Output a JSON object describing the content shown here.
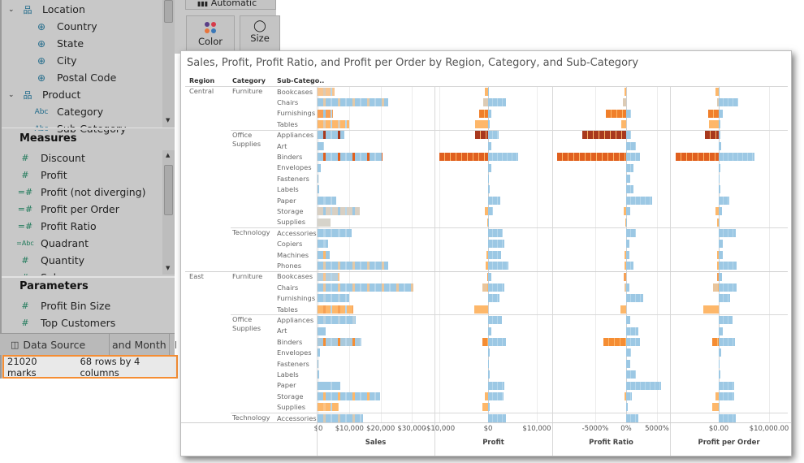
{
  "data_pane": {
    "dimensions": [
      {
        "label": "Location",
        "icon": "hierarchy-icon",
        "expanded": true,
        "children": [
          {
            "label": "Country",
            "icon": "globe-icon"
          },
          {
            "label": "State",
            "icon": "globe-icon"
          },
          {
            "label": "City",
            "icon": "globe-icon"
          },
          {
            "label": "Postal Code",
            "icon": "globe-icon"
          }
        ]
      },
      {
        "label": "Product",
        "icon": "hierarchy-icon",
        "expanded": true,
        "children": [
          {
            "label": "Category",
            "icon": "abc-icon"
          },
          {
            "label": "Sub-Category",
            "icon": "abc-icon"
          }
        ]
      }
    ],
    "measures_header": "Measures",
    "measures": [
      {
        "label": "Discount",
        "icon": "#"
      },
      {
        "label": "Profit",
        "icon": "#"
      },
      {
        "label": "Profit (not diverging)",
        "icon": "=#"
      },
      {
        "label": "Profit per Order",
        "icon": "=#"
      },
      {
        "label": "Profit Ratio",
        "icon": "=#"
      },
      {
        "label": "Quadrant",
        "icon": "=Abc"
      },
      {
        "label": "Quantity",
        "icon": "#"
      },
      {
        "label": "Sales",
        "icon": "#"
      }
    ],
    "parameters_header": "Parameters",
    "parameters": [
      {
        "label": "Profit Bin Size",
        "icon": "#"
      },
      {
        "label": "Top Customers",
        "icon": "#"
      }
    ]
  },
  "tabs": {
    "data_source": "Data Source",
    "sheet1": "and Month",
    "sheet2": "L"
  },
  "status": {
    "marks": "21020 marks",
    "dims": "68 rows by 4 columns"
  },
  "marks_card": {
    "type": "Automatic",
    "color": "Color",
    "size": "Size"
  },
  "colors": {
    "blue": "#9cc8e4",
    "accent": "#f58d33"
  },
  "viz": {
    "title": "Sales, Profit, Profit Ratio, and Profit per Order by Region, Category, and Sub-Category",
    "headers": {
      "region": "Region",
      "category": "Category",
      "subcategory": "Sub-Catego.."
    },
    "axes": [
      {
        "title": "Sales",
        "ticks": [
          {
            "v": 0,
            "t": "$0"
          },
          {
            "v": 10000,
            "t": "$10,000"
          },
          {
            "v": 20000,
            "t": "$20,000"
          },
          {
            "v": 30000,
            "t": "$30,000"
          }
        ]
      },
      {
        "title": "Profit",
        "ticks": [
          {
            "v": -10000,
            "t": "-$10,000"
          },
          {
            "v": 0,
            "t": "$0"
          },
          {
            "v": 10000,
            "t": "$10,000"
          }
        ]
      },
      {
        "title": "Profit Ratio",
        "ticks": [
          {
            "v": -5000,
            "t": "-5000%"
          },
          {
            "v": 0,
            "t": "0%"
          },
          {
            "v": 5000,
            "t": "5000%"
          }
        ]
      },
      {
        "title": "Profit per Order",
        "ticks": [
          {
            "v": 0,
            "t": "$0.00"
          },
          {
            "v": 10000,
            "t": "$10,000.00"
          }
        ]
      }
    ],
    "regions": [
      {
        "name": "Central",
        "categories": [
          {
            "name": "Furniture",
            "subs": [
              {
                "name": "Bookcases",
                "sales": 5500,
                "sc": "#f7c590",
                "sc2": "#dccbb5",
                "profit": [
                  -600,
                  200
                ],
                "ratio": [
                  -260,
                  0
                ],
                "ppo": [
                  -650,
                  200
                ],
                "nc": "#fdb76a"
              },
              {
                "name": "Chairs",
                "sales": 22700,
                "sc": "#9cc8e4",
                "sc2": "#e2c9a8",
                "profit": [
                  -950,
                  3600
                ],
                "ratio": [
                  -470,
                  0
                ],
                "ppo": [
                  -300,
                  3900
                ],
                "nc": "#dccbb5"
              },
              {
                "name": "Furnishings",
                "sales": 4900,
                "sc": "#f7a054",
                "sc2": "#9cc8e4",
                "profit": [
                  -1900,
                  600
                ],
                "ratio": [
                  -3300,
                  800
                ],
                "ppo": [
                  -2100,
                  800
                ],
                "nc": "#f07f2a"
              },
              {
                "name": "Tables",
                "sales": 10200,
                "sc": "#fdb76a",
                "sc2": "#dccbb5",
                "profit": [
                  -2600,
                  350
                ],
                "ratio": [
                  -750,
                  0
                ],
                "ppo": [
                  -1900,
                  300
                ],
                "nc": "#fdb76a"
              }
            ]
          },
          {
            "name": "Office Supplies",
            "subs": [
              {
                "name": "Appliances",
                "sales": 8600,
                "sc": "#9cc8e4",
                "sc2": "#a8391e",
                "profit": [
                  -2600,
                  2200
                ],
                "ratio": [
                  -7100,
                  800
                ],
                "ppo": [
                  -2700,
                  300
                ],
                "nc": "#a8391e"
              },
              {
                "name": "Art",
                "sales": 2100,
                "sc": "#9cc8e4",
                "sc2": "#b9d7ea",
                "profit": [
                  0,
                  600
                ],
                "ratio": [
                  0,
                  1600
                ],
                "ppo": [
                  0,
                  500
                ],
                "nc": "#fdb76a"
              },
              {
                "name": "Binders",
                "sales": 20900,
                "sc": "#9cc8e4",
                "sc2": "#e0601f",
                "profit": [
                  -10000,
                  6200
                ],
                "ratio": [
                  -11200,
                  2200
                ],
                "ppo": [
                  -8500,
                  7100
                ],
                "nc": "#e0601f"
              },
              {
                "name": "Envelopes",
                "sales": 1000,
                "sc": "#9cc8e4",
                "sc2": "#9cc8e4",
                "profit": [
                  0,
                  600
                ],
                "ratio": [
                  0,
                  1200
                ],
                "ppo": [
                  0,
                  300
                ],
                "nc": "#fdb76a"
              },
              {
                "name": "Fasteners",
                "sales": 300,
                "sc": "#9cc8e4",
                "sc2": "#9cc8e4",
                "profit": [
                  0,
                  100
                ],
                "ratio": [
                  0,
                  650
                ],
                "ppo": [
                  0,
                  150
                ],
                "nc": "#fdb76a"
              },
              {
                "name": "Labels",
                "sales": 500,
                "sc": "#9cc8e4",
                "sc2": "#9cc8e4",
                "profit": [
                  0,
                  300
                ],
                "ratio": [
                  0,
                  1200
                ],
                "ppo": [
                  0,
                  300
                ],
                "nc": "#fdb76a"
              },
              {
                "name": "Paper",
                "sales": 6000,
                "sc": "#9cc8e4",
                "sc2": "#b2d4ea",
                "profit": [
                  0,
                  2500
                ],
                "ratio": [
                  0,
                  4200
                ],
                "ppo": [
                  0,
                  2100
                ],
                "nc": "#fdb76a"
              },
              {
                "name": "Storage",
                "sales": 13500,
                "sc": "#d8cfc2",
                "sc2": "#9cc8e4",
                "profit": [
                  -600,
                  1000
                ],
                "ratio": [
                  -400,
                  650
                ],
                "ppo": [
                  -650,
                  650
                ],
                "nc": "#fdb76a"
              },
              {
                "name": "Supplies",
                "sales": 4200,
                "sc": "#d6d3ca",
                "sc2": "#d6d3ca",
                "profit": [
                  -200,
                  100
                ],
                "ratio": [
                  -100,
                  100
                ],
                "ppo": [
                  -300,
                  100
                ],
                "nc": "#fdb76a"
              }
            ]
          },
          {
            "name": "Technology",
            "subs": [
              {
                "name": "Accessories",
                "sales": 11000,
                "sc": "#9cc8e4",
                "sc2": "#b2d4ea",
                "profit": [
                  0,
                  3000
                ],
                "ratio": [
                  0,
                  1600
                ],
                "ppo": [
                  0,
                  3400
                ],
                "nc": "#fdb76a"
              },
              {
                "name": "Copiers",
                "sales": 3400,
                "sc": "#9cc8e4",
                "sc2": "#b2d4ea",
                "profit": [
                  0,
                  3300
                ],
                "ratio": [
                  0,
                  500
                ],
                "ppo": [
                  0,
                  800
                ],
                "nc": "#fdb76a"
              },
              {
                "name": "Machines",
                "sales": 4000,
                "sc": "#9cc8e4",
                "sc2": "#fdb76a",
                "profit": [
                  -300,
                  2700
                ],
                "ratio": [
                  -300,
                  500
                ],
                "ppo": [
                  -300,
                  800
                ],
                "nc": "#fdb76a"
              },
              {
                "name": "Phones",
                "sales": 22700,
                "sc": "#9cc8e4",
                "sc2": "#e2c9a8",
                "profit": [
                  -500,
                  4200
                ],
                "ratio": [
                  -200,
                  1200
                ],
                "ppo": [
                  -300,
                  3500
                ],
                "nc": "#fdb76a"
              }
            ]
          }
        ]
      },
      {
        "name": "East",
        "categories": [
          {
            "name": "Furniture",
            "subs": [
              {
                "name": "Bookcases",
                "sales": 7000,
                "sc": "#b5cedd",
                "sc2": "#f7c590",
                "profit": [
                  -200,
                  700
                ],
                "ratio": [
                  -380,
                  0
                ],
                "ppo": [
                  -400,
                  700
                ],
                "nc": "#f7a054"
              },
              {
                "name": "Chairs",
                "sales": 30800,
                "sc": "#9cc8e4",
                "sc2": "#e9c59c",
                "profit": [
                  -1100,
                  3400
                ],
                "ratio": [
                  -300,
                  500
                ],
                "ppo": [
                  -1200,
                  3600
                ],
                "nc": "#e9c59c"
              },
              {
                "name": "Furnishings",
                "sales": 10200,
                "sc": "#9cc8e4",
                "sc2": "#b8d2e2",
                "profit": [
                  0,
                  2300
                ],
                "ratio": [
                  0,
                  2800
                ],
                "ppo": [
                  0,
                  2200
                ],
                "nc": "#fdb76a"
              },
              {
                "name": "Tables",
                "sales": 11500,
                "sc": "#fdb76a",
                "sc2": "#f7a054",
                "profit": [
                  -2800,
                  0
                ],
                "ratio": [
                  -900,
                  0
                ],
                "ppo": [
                  -3000,
                  0
                ],
                "nc": "#fdb76a"
              }
            ]
          },
          {
            "name": "Office Supplies",
            "subs": [
              {
                "name": "Appliances",
                "sales": 12300,
                "sc": "#9cc8e4",
                "sc2": "#b8d2e2",
                "profit": [
                  0,
                  2900
                ],
                "ratio": [
                  0,
                  700
                ],
                "ppo": [
                  0,
                  2800
                ],
                "nc": "#fdb76a"
              },
              {
                "name": "Art",
                "sales": 2600,
                "sc": "#9cc8e4",
                "sc2": "#9cc8e4",
                "profit": [
                  0,
                  700
                ],
                "ratio": [
                  0,
                  2000
                ],
                "ppo": [
                  0,
                  800
                ],
                "nc": "#fdb76a"
              },
              {
                "name": "Binders",
                "sales": 14000,
                "sc": "#a9c9dc",
                "sc2": "#f58d33",
                "profit": [
                  -1200,
                  3700
                ],
                "ratio": [
                  -3700,
                  2300
                ],
                "ppo": [
                  -1250,
                  3300
                ],
                "nc": "#f58d33"
              },
              {
                "name": "Envelopes",
                "sales": 800,
                "sc": "#9cc8e4",
                "sc2": "#9cc8e4",
                "profit": [
                  0,
                  400
                ],
                "ratio": [
                  0,
                  800
                ],
                "ppo": [
                  0,
                  500
                ],
                "nc": "#fdb76a"
              },
              {
                "name": "Fasteners",
                "sales": 200,
                "sc": "#9cc8e4",
                "sc2": "#9cc8e4",
                "profit": [
                  0,
                  200
                ],
                "ratio": [
                  0,
                  600
                ],
                "ppo": [
                  0,
                  150
                ],
                "nc": "#fdb76a"
              },
              {
                "name": "Labels",
                "sales": 500,
                "sc": "#9cc8e4",
                "sc2": "#9cc8e4",
                "profit": [
                  0,
                  400
                ],
                "ratio": [
                  0,
                  1600
                ],
                "ppo": [
                  0,
                  400
                ],
                "nc": "#fdb76a"
              },
              {
                "name": "Paper",
                "sales": 7300,
                "sc": "#9cc8e4",
                "sc2": "#9cc8e4",
                "profit": [
                  0,
                  3400
                ],
                "ratio": [
                  0,
                  5700
                ],
                "ppo": [
                  0,
                  3000
                ],
                "nc": "#fdb76a"
              },
              {
                "name": "Storage",
                "sales": 20100,
                "sc": "#9cc8e4",
                "sc2": "#fdb76a",
                "profit": [
                  -600,
                  3200
                ],
                "ratio": [
                  -300,
                  950
                ],
                "ppo": [
                  -700,
                  3100
                ],
                "nc": "#fdb76a"
              },
              {
                "name": "Supplies",
                "sales": 6800,
                "sc": "#fdb76a",
                "sc2": "#fdc485",
                "profit": [
                  -1100,
                  250
                ],
                "ratio": [
                  0,
                  300
                ],
                "ppo": [
                  -1300,
                  150
                ],
                "nc": "#fdb76a"
              }
            ]
          },
          {
            "name": "Technology",
            "subs": [
              {
                "name": "Accessories",
                "sales": 14600,
                "sc": "#9cc8e4",
                "sc2": "#d5c9b5",
                "profit": [
                  0,
                  3600
                ],
                "ratio": [
                  0,
                  1950
                ],
                "ppo": [
                  0,
                  3400
                ],
                "nc": "#fdb76a"
              }
            ]
          }
        ]
      }
    ]
  }
}
